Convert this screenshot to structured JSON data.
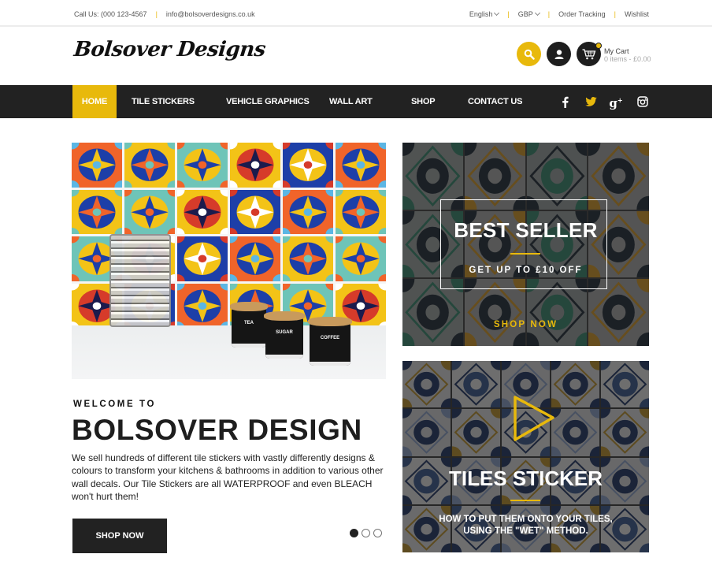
{
  "topbar": {
    "phone": "Call Us: (000 123-4567",
    "email": "info@bolsoverdesigns.co.uk",
    "language": "English",
    "currency": "GBP",
    "order_tracking": "Order Tracking",
    "wishlist": "Wishlist"
  },
  "header": {
    "logo": "Bolsover Designs",
    "icons": [
      "search-icon",
      "user-icon",
      "cart-icon"
    ],
    "cart_label": "My Cart",
    "cart_summary": "0 items - £0.00"
  },
  "nav": {
    "items": [
      {
        "label": "HOME",
        "active": true
      },
      {
        "label": "TILE STICKERS"
      },
      {
        "label": "VEHICLE GRAPHICS"
      },
      {
        "label": "WALL ART"
      },
      {
        "label": "SHOP"
      },
      {
        "label": "CONTACT US"
      }
    ],
    "social": [
      "facebook-icon",
      "twitter-icon",
      "google-plus-icon",
      "instagram-icon"
    ]
  },
  "hero": {
    "jars": [
      "TEA",
      "SUGAR",
      "COFFEE"
    ],
    "welcome": "WELCOME TO",
    "title": "BOLSOVER DESIGN",
    "description": "We sell hundreds of different tile stickers with vastly differently designs & colours to transform your kitchens & bathrooms in addition to various other wall decals. Our Tile Stickers are all WATERPROOF and even BLEACH won't hurt them!",
    "button": "SHOP NOW",
    "slides": 3,
    "active_slide": 1
  },
  "promo_best_seller": {
    "title": "BEST SELLER",
    "subtitle": "GET UP TO £10 OFF",
    "cta": "SHOP NOW"
  },
  "promo_video": {
    "title": "TILES STICKER",
    "subtitle_line1": "HOW TO PUT THEM ONTO YOUR TILES,",
    "subtitle_line2": "USING THE \"WET\" METHOD."
  },
  "colors": {
    "accent": "#e8b90c",
    "dark": "#222222"
  }
}
